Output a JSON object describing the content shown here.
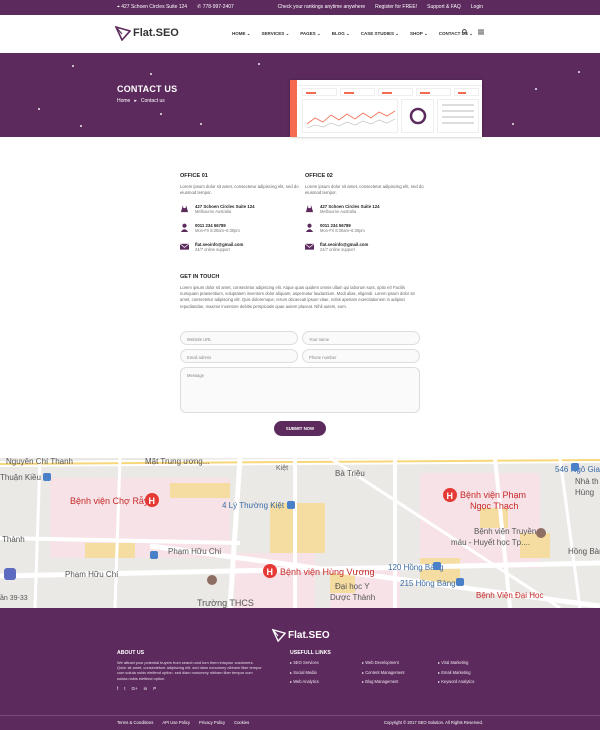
{
  "topbar": {
    "address": "427 Schoen Circles Suite 124",
    "phone": "778-997-2407",
    "rankings_link": "Check your rankings anytime anywhere",
    "register": "Register for FREE!",
    "support": "Support & FAQ",
    "login": "Login"
  },
  "brand": {
    "logo_text": "Flat.SEO"
  },
  "nav": {
    "items": [
      "HOME",
      "SERVICES",
      "PAGES",
      "BLOG",
      "CASE STUDIES",
      "SHOP",
      "CONTACT US"
    ]
  },
  "hero": {
    "title": "CONTACT US",
    "breadcrumb_home": "Home",
    "breadcrumb_current": "Contact us"
  },
  "offices": [
    {
      "title": "OFFICE 01",
      "desc": "Lorem ipsum dolor sit amet, consectetur adipiscing elit, sed do eiusmod tempor.",
      "address_1": "427 Schoen Circles Suite 124",
      "address_2": "Melbourne Australia",
      "phone_1": "0011 234 56789",
      "phone_2": "Mon-Fri 8:30am–6:30pm",
      "email_1": "flat.seoinfo@gmail.com",
      "email_2": "24/7 online support"
    },
    {
      "title": "OFFICE 02",
      "desc": "Lorem ipsum dolor sit amet, consectetur adipiscing elit, sed do eiusmod tempor.",
      "address_1": "427 Schoen Circles Suite 124",
      "address_2": "Melbourne Australia",
      "phone_1": "0011 234 56789",
      "phone_2": "Mon-Fri 8:30am–6:30pm",
      "email_1": "flat.seoinfo@gmail.com",
      "email_2": "24/7 online support"
    }
  ],
  "get_in_touch": {
    "title": "GET IN TOUCH",
    "text": "Lorem ipsum dolor sit amet, consectetur adipiscing elit. Atque quas quidem omnis ullam qui laborum sunt, optio et! Facilis numquam praesentium, voluptatem inventore dolor aliquam, aspernatur laudantium. Modi alias, eligendi. Lorem ipsum dolor sit amet, consectetur adipiscing elit. Quis doloremque, rerum obcaecati ipsum vitae, nobis aperiam exercitationem in adipisci repudiandae, maxime inventore debitis perspiciatis quae autem placeat. Nihil autem, eum."
  },
  "form": {
    "website_placeholder": "Website URL",
    "name_placeholder": "Your name",
    "email_placeholder": "Email adress",
    "phone_placeholder": "Phone number",
    "message_placeholder": "Message",
    "submit_label": "SUBMIT NOW"
  },
  "map": {
    "labels": {
      "street_1": "Nguyễn Chí Thanh",
      "street_2": "Thuận Kiều",
      "street_3": "Mặt Trung ương...",
      "hospital_1": "Bệnh viện Chợ Rẫy",
      "street_4": "4 Lý Thường Kiệt",
      "street_5": "Kiệt",
      "street_6": "Bà Triệu",
      "street_7": "546 Ngô Gia",
      "hospital_2a": "Bệnh viện Phạm",
      "hospital_2b": "Ngọc Thạch",
      "place_1": "Nhà th",
      "place_2": "Hùng",
      "hospital_3a": "Bệnh viện Truyền",
      "hospital_3b": "máu - Huyết học Tp....",
      "street_8": "Thành",
      "street_9": "Phạm Hữu Chí",
      "street_10": "Phạm Hữu Chí",
      "hospital_4": "Bệnh viện Hùng Vương",
      "street_11": "120 Hồng Bàng",
      "street_12": "Hồng Bàng",
      "school": "Trường THCS",
      "place_3a": "Đại học Y",
      "place_3b": "Dược Thành",
      "street_13": "215 Hồng Bàng",
      "hospital_5": "Bệnh Viện Đại Học",
      "street_14": "ần 39-33"
    }
  },
  "footer": {
    "logo_text": "Flat.SEO",
    "about_title": "ABOUT US",
    "about_text": "We attract your potential buyers from search and turn them intoyour customers. Qolor sit amet, consectetuer adipiscing elit, sed diam nonummy nibham liber tempor cum soluta nobis eleifend option. sed diam nonummy nibham liber tempor cum soluta nobis eleifend option.",
    "social_icons": [
      "facebook-icon",
      "twitter-icon",
      "google-plus-icon",
      "linkedin-icon",
      "pinterest-icon"
    ],
    "social_glyphs": [
      "f",
      "t",
      "G+",
      "in",
      "P"
    ],
    "links_title": "USEFULL LINKS",
    "links": [
      "SEO Services",
      "Web Development",
      "Viral Marketing",
      "Social Media",
      "Content Management",
      "Email Marketing",
      "Web Analytics",
      "Blog Management",
      "Keyword Analytics"
    ],
    "bottom_links": [
      "Terms & Conditions",
      "API Use Policy",
      "Privacy Policy",
      "Cookies"
    ],
    "copyright": "Copyright © 2017 SEO Solution. All Rights Reserved."
  },
  "colors": {
    "brand": "#5c2a5d",
    "accent": "#f46b51",
    "hospital_red": "#e53935"
  }
}
